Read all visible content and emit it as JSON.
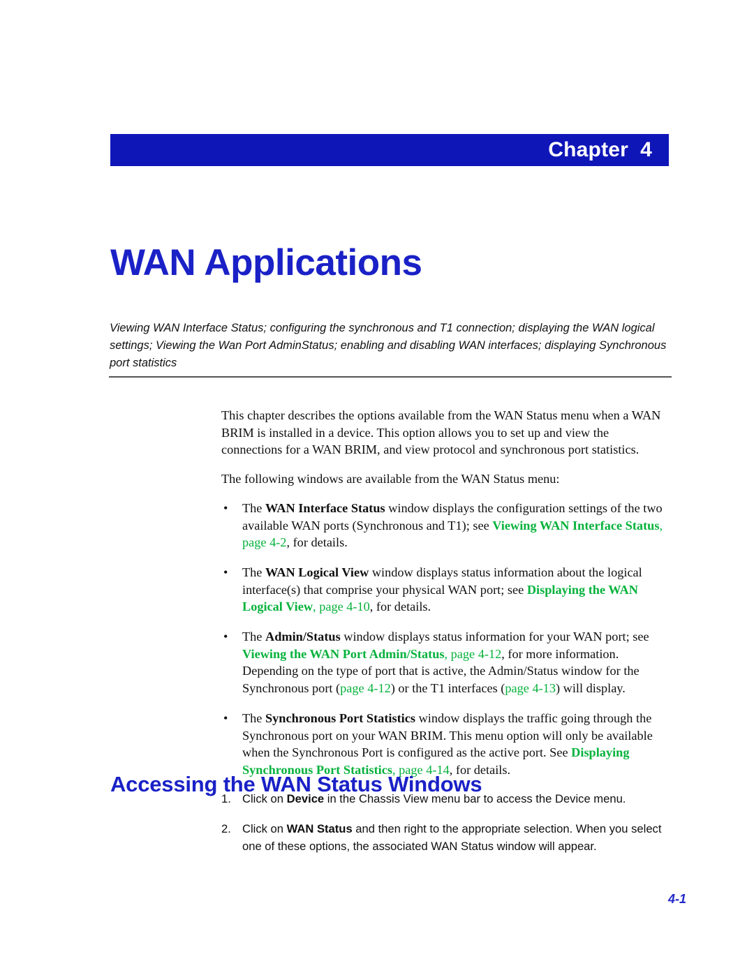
{
  "banner": {
    "chapter_label": "Chapter  4"
  },
  "title": "WAN Applications",
  "abstract": "Viewing WAN Interface Status; configuring the synchronous and T1 connection; displaying the WAN logical settings; Viewing the Wan Port AdminStatus; enabling and disabling WAN interfaces; displaying Synchronous port statistics",
  "body": {
    "intro_paragraph": "This chapter describes the options available from the WAN Status menu when a WAN BRIM is installed in a device. This option allows you to set up and view the connections for a WAN BRIM, and view protocol and synchronous port statistics.",
    "lead_in": "The following windows are available from the WAN Status menu:",
    "bullet_glyph": "•",
    "bullets": [
      {
        "seg1": "The ",
        "bold1": "WAN Interface Status",
        "seg2": " window displays the configuration settings of the two available WAN ports (Synchronous and T1); see ",
        "xref": "Viewing WAN Interface Status",
        "seg3": ", ",
        "xpage": "page 4-2",
        "seg4": ", for details."
      },
      {
        "seg1": "The ",
        "bold1": "WAN Logical View",
        "seg2": " window displays status information about the logical interface(s) that comprise your physical WAN port; see ",
        "xref": "Displaying the WAN Logical View",
        "seg3": ", ",
        "xpage": "page 4-10",
        "seg4": ", for details."
      },
      {
        "seg1": "The ",
        "bold1": "Admin/Status",
        "seg2": " window displays status information for your WAN port; see ",
        "xref": "Viewing the WAN Port Admin/Status",
        "seg3": ", ",
        "xpage": "page 4-12",
        "seg4": ", for more information. Depending on the type of port that is active, the Admin/Status window for the Synchronous port (",
        "xpage2": "page 4-12",
        "seg5": ") or the T1 interfaces (",
        "xpage3": "page 4-13",
        "seg6": ") will display."
      },
      {
        "seg1": "The ",
        "bold1": "Synchronous Port Statistics",
        "seg2": " window displays the traffic going through the Synchronous port on your WAN BRIM. This menu option will only be available when the Synchronous Port is configured as the active port. See ",
        "xref": "Displaying Synchronous Port Statistics",
        "seg3": ", ",
        "xpage": "page 4-14",
        "seg4": ", for details."
      }
    ]
  },
  "section": {
    "heading": "Accessing the WAN Status Windows",
    "steps": [
      {
        "number": "1.",
        "seg1": "Click on ",
        "bold1": "Device",
        "seg2": " in the Chassis View menu bar to access the Device menu."
      },
      {
        "number": "2.",
        "seg1": "Click on ",
        "bold1": "WAN Status",
        "seg2": " and then right to the appropriate selection. When you select one of these options, the associated WAN Status window will appear."
      }
    ]
  },
  "footer": {
    "page_number": "4-1"
  },
  "colors": {
    "banner_blue": "#0f16b8",
    "heading_blue": "#1a21c6",
    "xref_green": "#06b23c",
    "rule_gray": "#555555",
    "folio_blue": "#2229c9"
  }
}
